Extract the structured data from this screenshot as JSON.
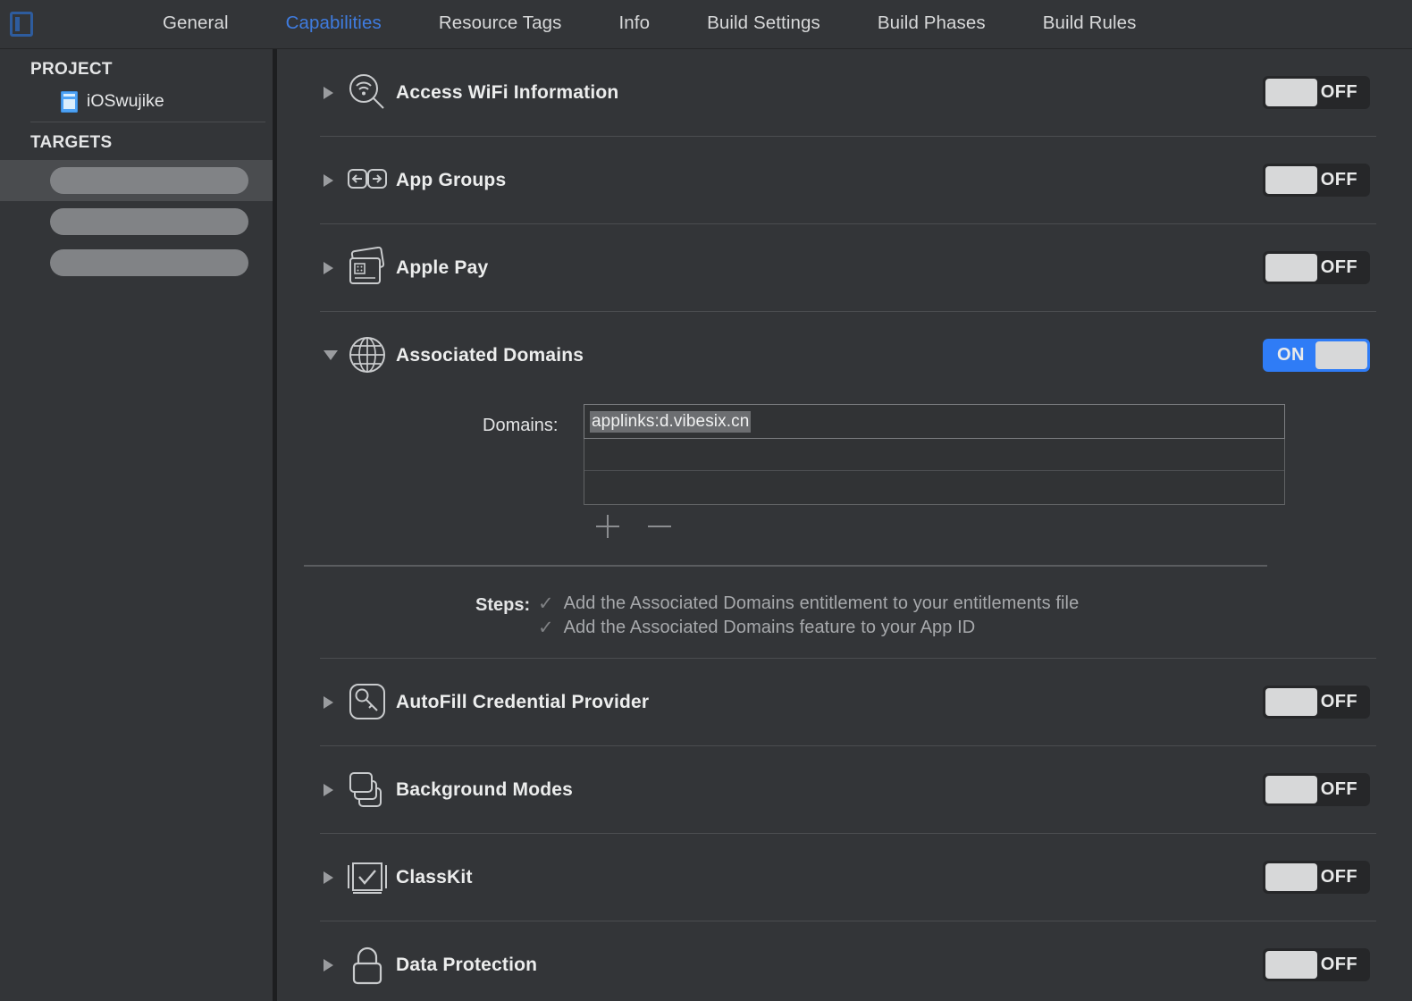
{
  "window": {
    "sidebar_toggle_icon": "sidebar-toggle-icon"
  },
  "tabs": [
    {
      "label": "General",
      "active": false
    },
    {
      "label": "Capabilities",
      "active": true
    },
    {
      "label": "Resource Tags",
      "active": false
    },
    {
      "label": "Info",
      "active": false
    },
    {
      "label": "Build Settings",
      "active": false
    },
    {
      "label": "Build Phases",
      "active": false
    },
    {
      "label": "Build Rules",
      "active": false
    }
  ],
  "sidebar": {
    "project_header": "PROJECT",
    "project_item": {
      "label": "iOSwujike",
      "icon": "project-document-icon"
    },
    "targets_header": "TARGETS",
    "targets": [
      {
        "label": "",
        "redacted": true,
        "selected": true
      },
      {
        "label": "",
        "redacted": true,
        "selected": false
      },
      {
        "label": "",
        "redacted": true,
        "selected": false
      }
    ]
  },
  "capabilities": [
    {
      "name": "Access WiFi Information",
      "icon": "wifi-search-icon",
      "state": "OFF",
      "expanded": false
    },
    {
      "name": "App Groups",
      "icon": "app-groups-icon",
      "state": "OFF",
      "expanded": false
    },
    {
      "name": "Apple Pay",
      "icon": "apple-pay-card-icon",
      "state": "OFF",
      "expanded": false
    },
    {
      "name": "Associated Domains",
      "icon": "globe-icon",
      "state": "ON",
      "expanded": true
    },
    {
      "name": "AutoFill Credential Provider",
      "icon": "key-icon",
      "state": "OFF",
      "expanded": false
    },
    {
      "name": "Background Modes",
      "icon": "stacked-cards-icon",
      "state": "OFF",
      "expanded": false
    },
    {
      "name": "ClassKit",
      "icon": "checkbox-icon",
      "state": "OFF",
      "expanded": false
    },
    {
      "name": "Data Protection",
      "icon": "lock-icon",
      "state": "OFF",
      "expanded": false
    }
  ],
  "associated_domains": {
    "domains_label": "Domains:",
    "domains": [
      {
        "value": "applinks:d.vibesix.cn",
        "selected": true
      },
      {
        "value": "",
        "selected": false
      },
      {
        "value": "",
        "selected": false
      }
    ],
    "add_button": "+",
    "remove_button": "−",
    "steps_label": "Steps:",
    "steps": [
      {
        "check": "✓",
        "text": "Add the Associated Domains entitlement to your entitlements file"
      },
      {
        "check": "✓",
        "text": "Add the Associated Domains feature to your App ID"
      }
    ]
  },
  "colors": {
    "background": "#333538",
    "accent_blue": "#3f7ce0",
    "toggle_on": "#2f7cf6",
    "toggle_off": "#262729",
    "text": "#eceded",
    "muted_text": "#a7a9ac"
  }
}
